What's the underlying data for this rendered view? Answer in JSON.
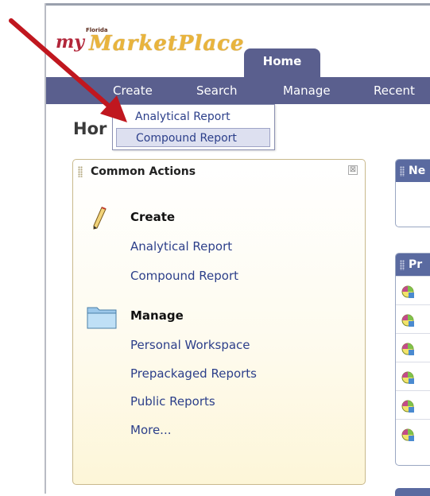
{
  "header": {
    "logo": {
      "prefix": "my",
      "state": "Florida",
      "name": "MarketPlace"
    },
    "active_tab": "Home"
  },
  "nav": {
    "items": [
      {
        "label": "Create"
      },
      {
        "label": "Search"
      },
      {
        "label": "Manage"
      },
      {
        "label": "Recent"
      }
    ]
  },
  "create_menu": {
    "items": [
      {
        "label": "Analytical Report",
        "selected": false
      },
      {
        "label": "Compound Report",
        "selected": true
      }
    ]
  },
  "page": {
    "title": "Hor"
  },
  "common_actions": {
    "title": "Common Actions",
    "close_glyph": "⊠",
    "create": {
      "heading": "Create",
      "icon": "pencil-icon",
      "links": [
        "Analytical Report",
        "Compound Report"
      ]
    },
    "manage": {
      "heading": "Manage",
      "icon": "folder-icon",
      "links": [
        "Personal Workspace",
        "Prepackaged Reports",
        "Public Reports",
        "More..."
      ]
    }
  },
  "side_panels": {
    "news_title": "Ne",
    "reports_title": "Pr",
    "report_icons": [
      "report-icon",
      "report-icon",
      "report-icon",
      "report-icon",
      "report-icon",
      "report-icon"
    ]
  },
  "colors": {
    "nav_bg": "#5a5f8e",
    "link": "#2c3f8a",
    "panel_border": "#c9b98c",
    "arrow": "#c0171f"
  }
}
